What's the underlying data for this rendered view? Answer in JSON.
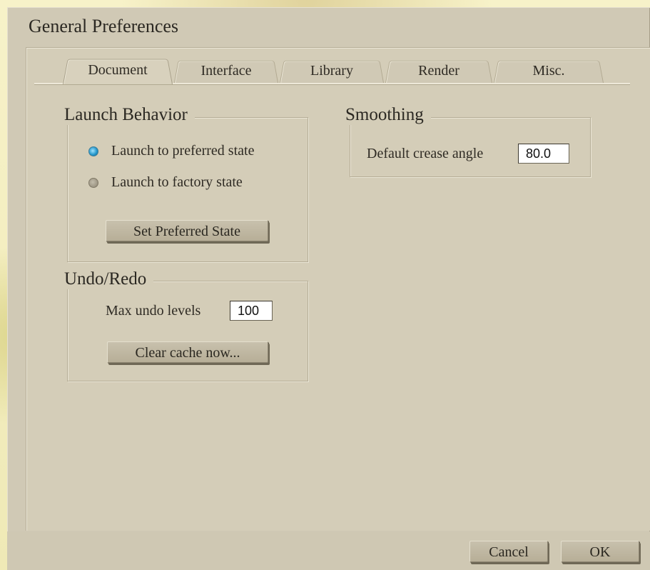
{
  "window": {
    "title": "General Preferences"
  },
  "tabs": [
    {
      "label": "Document",
      "active": true
    },
    {
      "label": "Interface",
      "active": false
    },
    {
      "label": "Library",
      "active": false
    },
    {
      "label": "Render",
      "active": false
    },
    {
      "label": "Misc.",
      "active": false
    }
  ],
  "launch_behavior": {
    "title": "Launch Behavior",
    "options": [
      {
        "label": "Launch to preferred state",
        "selected": true
      },
      {
        "label": "Launch to factory state",
        "selected": false
      }
    ],
    "button_label": "Set Preferred State"
  },
  "undo_redo": {
    "title": "Undo/Redo",
    "max_levels_label": "Max undo levels",
    "max_levels_value": "100",
    "clear_button_label": "Clear cache now..."
  },
  "smoothing": {
    "title": "Smoothing",
    "crease_label": "Default crease angle",
    "crease_value": "80.0"
  },
  "footer": {
    "cancel_label": "Cancel",
    "ok_label": "OK"
  },
  "colors": {
    "dialog_bg": "#d0c9b5",
    "radio_selected": "#1f93c8"
  }
}
